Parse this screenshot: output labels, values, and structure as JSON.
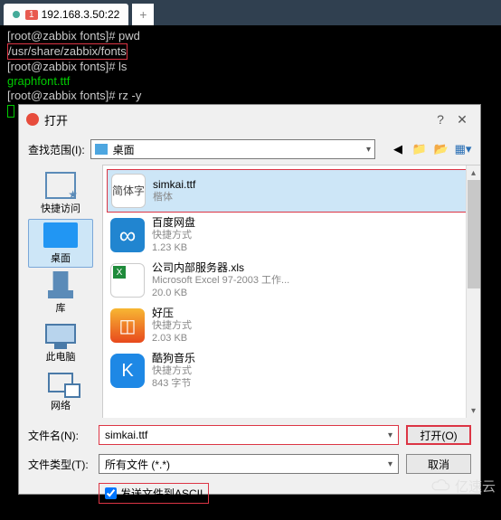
{
  "tab": {
    "num": "1",
    "title": "192.168.3.50:22"
  },
  "terminal": {
    "line1_prompt": "[root@zabbix fonts]# ",
    "line1_cmd": "pwd",
    "line2": "/usr/share/zabbix/fonts",
    "line3_prompt": "[root@zabbix fonts]# ",
    "line3_cmd": "ls",
    "line4": "graphfont.ttf",
    "line5_prompt": "[root@zabbix fonts]# ",
    "line5_cmd": "rz -y"
  },
  "dialog": {
    "title": "打开",
    "lookup_label": "查找范围(I):",
    "lookup_value": "桌面",
    "sidebar": [
      {
        "label": "快捷访问"
      },
      {
        "label": "桌面"
      },
      {
        "label": "库"
      },
      {
        "label": "此电脑"
      },
      {
        "label": "网络"
      }
    ],
    "files": [
      {
        "name": "simkai.ttf",
        "meta": "楷体",
        "icon_text": "简体字"
      },
      {
        "name": "百度网盘",
        "meta1": "快捷方式",
        "meta2": "1.23 KB"
      },
      {
        "name": "公司内部服务器.xls",
        "meta1": "Microsoft Excel 97-2003 工作...",
        "meta2": "20.0 KB"
      },
      {
        "name": "好压",
        "meta1": "快捷方式",
        "meta2": "2.03 KB"
      },
      {
        "name": "酷狗音乐",
        "meta1": "快捷方式",
        "meta2": "843 字节"
      }
    ],
    "filename_label": "文件名(N):",
    "filename_value": "simkai.ttf",
    "filetype_label": "文件类型(T):",
    "filetype_value": "所有文件 (*.*)",
    "open_btn": "打开(O)",
    "cancel_btn": "取消",
    "ascii_label": "发送文件到ASCII"
  },
  "watermark": "亿速云"
}
